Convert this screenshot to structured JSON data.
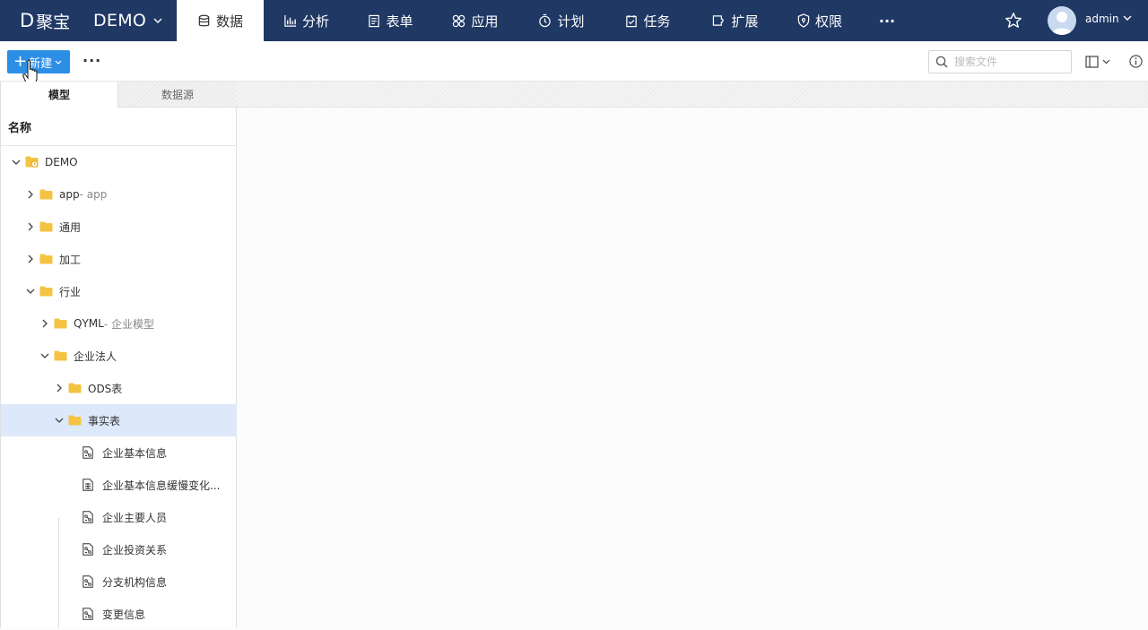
{
  "brand": {
    "logo_letter": "D",
    "logo_text": "聚宝",
    "project": "DEMO"
  },
  "nav": {
    "tabs": [
      {
        "label": "数据",
        "icon": "database-icon"
      },
      {
        "label": "分析",
        "icon": "bar-chart-icon"
      },
      {
        "label": "表单",
        "icon": "form-icon"
      },
      {
        "label": "应用",
        "icon": "apps-icon"
      },
      {
        "label": "计划",
        "icon": "stopwatch-icon"
      },
      {
        "label": "任务",
        "icon": "task-check-icon"
      },
      {
        "label": "扩展",
        "icon": "extension-icon"
      },
      {
        "label": "权限",
        "icon": "shield-icon"
      }
    ],
    "more": "···",
    "active": "数据"
  },
  "user": {
    "name": "admin"
  },
  "toolbar": {
    "new_label": "新建",
    "more_label": "···",
    "search_placeholder": "搜索文件"
  },
  "panel": {
    "tabs": [
      "模型",
      "数据源"
    ],
    "active_tab": "模型",
    "column_header": "名称"
  },
  "tree": [
    {
      "label": "DEMO",
      "sub": "",
      "depth": 0,
      "expanded": true,
      "type": "root-folder"
    },
    {
      "label": "app",
      "sub": " - app",
      "depth": 1,
      "expanded": false,
      "type": "folder"
    },
    {
      "label": "通用",
      "sub": "",
      "depth": 1,
      "expanded": false,
      "type": "folder"
    },
    {
      "label": "加工",
      "sub": "",
      "depth": 1,
      "expanded": false,
      "type": "folder"
    },
    {
      "label": "行业",
      "sub": "",
      "depth": 1,
      "expanded": true,
      "type": "folder"
    },
    {
      "label": "QYML",
      "sub": " - 企业模型",
      "depth": 2,
      "expanded": false,
      "type": "folder"
    },
    {
      "label": "企业法人",
      "sub": "",
      "depth": 2,
      "expanded": true,
      "type": "folder"
    },
    {
      "label": "ODS表",
      "sub": "",
      "depth": 3,
      "expanded": false,
      "type": "folder"
    },
    {
      "label": "事实表",
      "sub": "",
      "depth": 3,
      "expanded": true,
      "type": "folder",
      "selected": true
    },
    {
      "label": "企业基本信息",
      "sub": "",
      "depth": 4,
      "type": "model"
    },
    {
      "label": "企业基本信息缓慢变化...",
      "sub": "",
      "depth": 4,
      "type": "table"
    },
    {
      "label": "企业主要人员",
      "sub": "",
      "depth": 4,
      "type": "model"
    },
    {
      "label": "企业投资关系",
      "sub": "",
      "depth": 4,
      "type": "model"
    },
    {
      "label": "分支机构信息",
      "sub": "",
      "depth": 4,
      "type": "model"
    },
    {
      "label": "变更信息",
      "sub": "",
      "depth": 4,
      "type": "model"
    }
  ],
  "colors": {
    "nav_bg": "#203864",
    "accent": "#2d8ee6",
    "folder": "#f5c342",
    "selected_row": "#dde9fa"
  }
}
